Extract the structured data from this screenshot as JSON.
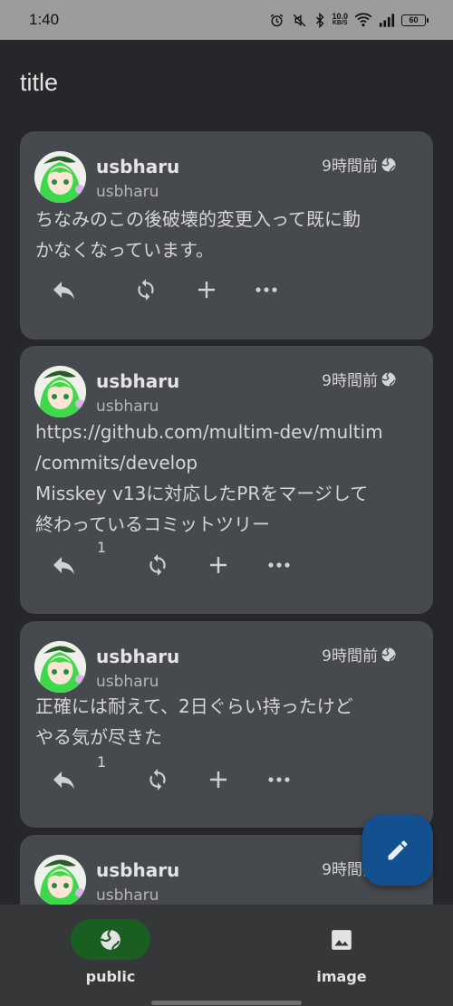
{
  "status_bar": {
    "time": "1:40",
    "net_speed_value": "10.0",
    "net_speed_unit": "KB/S",
    "battery": "60"
  },
  "app_bar": {
    "title": "title"
  },
  "notes": [
    {
      "username": "usbharu",
      "handle": "usbharu",
      "time": "9時間前",
      "text": "ちなみのこの後破壊的変更入って既に動\nかなくなっています。",
      "reply_count": ""
    },
    {
      "username": "usbharu",
      "handle": "usbharu",
      "time": "9時間前",
      "text": "https://github.com/multim-dev/multim\n/commits/develop\nMisskey v13に対応したPRをマージして\n終わっているコミットツリー",
      "reply_count": "1"
    },
    {
      "username": "usbharu",
      "handle": "usbharu",
      "time": "9時間前",
      "text": "正確には耐えて、2日ぐらい持ったけど\nやる気が尽きた",
      "reply_count": "1"
    },
    {
      "username": "usbharu",
      "handle": "usbharu",
      "time": "9時間前",
      "text": "",
      "reply_count": ""
    }
  ],
  "bottom_nav": {
    "items": [
      {
        "label": "public",
        "icon": "globe-icon",
        "active": true
      },
      {
        "label": "image",
        "icon": "image-icon",
        "active": false
      }
    ]
  },
  "colors": {
    "background": "#25272a",
    "card": "#46494d",
    "fab": "#13508f",
    "nav_active": "#1a5e22",
    "avatar_hair": "#3fd84a"
  }
}
